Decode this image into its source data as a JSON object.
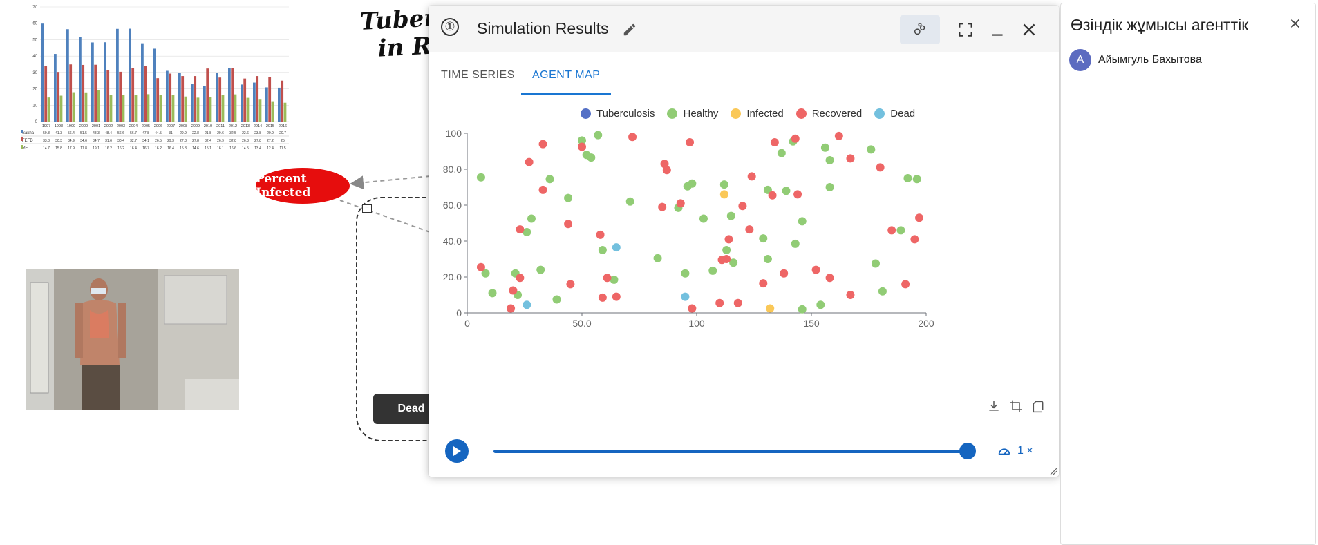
{
  "canvas": {
    "title_fragment": "Tuberc\n  in Ru",
    "percent_infected_label": "Percent Infected",
    "dead_node_label": "Dead",
    "mini_chart": {
      "years": [
        "1997",
        "1998",
        "1999",
        "2000",
        "2001",
        "2002",
        "2003",
        "2004",
        "2005",
        "2006",
        "2007",
        "2008",
        "2009",
        "2010",
        "2011",
        "2012",
        "2013",
        "2014",
        "2015",
        "2016"
      ],
      "y_ticks": [
        "70",
        "60",
        "50",
        "40",
        "30",
        "20",
        "10",
        "0"
      ],
      "rows": [
        {
          "label": "Sakha",
          "color": "#4f81bd",
          "values": [
            "59.8",
            "41.3",
            "56.4",
            "51.5",
            "48.3",
            "48.4",
            "56.6",
            "56.7",
            "47.8",
            "44.5",
            "31",
            "29.9",
            "22.8",
            "21.8",
            "29.6",
            "32.5",
            "22.6",
            "23.8",
            "20.9",
            "20.7"
          ]
        },
        {
          "label": "FEFD",
          "color": "#c0504d",
          "values": [
            "33.8",
            "30.3",
            "34.9",
            "34.6",
            "34.7",
            "31.6",
            "30.4",
            "32.7",
            "34.1",
            "26.5",
            "29.3",
            "27.8",
            "27.8",
            "32.4",
            "26.9",
            "32.8",
            "26.3",
            "27.8",
            "27.2",
            "25"
          ]
        },
        {
          "label": "RF",
          "color": "#9bbb59",
          "values": [
            "14.7",
            "15.8",
            "17.9",
            "17.8",
            "19.1",
            "16.2",
            "16.2",
            "16.4",
            "16.7",
            "16.2",
            "16.4",
            "15.3",
            "14.6",
            "15.1",
            "16.1",
            "16.6",
            "14.5",
            "13.4",
            "12.4",
            "11.5"
          ]
        }
      ]
    }
  },
  "modal": {
    "number": "①",
    "title": "Simulation Results",
    "tabs": [
      {
        "label": "TIME SERIES",
        "active": false
      },
      {
        "label": "AGENT MAP",
        "active": true
      }
    ],
    "speed_label": "1 ×",
    "playback_progress_percent": 100
  },
  "chart_data": {
    "type": "scatter",
    "xlim": [
      0,
      200
    ],
    "ylim": [
      0,
      100
    ],
    "x_ticks": [
      "0",
      "50.0",
      "100",
      "150",
      "200"
    ],
    "y_ticks": [
      "0",
      "20.0",
      "40.0",
      "60.0",
      "80.0",
      "100"
    ],
    "legend_position": "top",
    "series": [
      {
        "name": "Tuberculosis",
        "color": "#5470c6",
        "points": []
      },
      {
        "name": "Healthy",
        "color": "#91cc75",
        "points": [
          [
            6,
            75.5
          ],
          [
            8,
            22
          ],
          [
            11,
            11
          ],
          [
            21,
            22
          ],
          [
            22,
            10
          ],
          [
            26,
            45
          ],
          [
            28,
            52.5
          ],
          [
            32,
            24
          ],
          [
            36,
            74.5
          ],
          [
            39,
            7.5
          ],
          [
            44,
            64
          ],
          [
            50,
            96
          ],
          [
            52,
            88
          ],
          [
            54,
            86.5
          ],
          [
            57,
            99
          ],
          [
            59,
            35
          ],
          [
            64,
            18.5
          ],
          [
            71,
            62
          ],
          [
            83,
            30.5
          ],
          [
            92,
            58.5
          ],
          [
            95,
            22
          ],
          [
            96,
            70.5
          ],
          [
            98,
            72
          ],
          [
            103,
            52.5
          ],
          [
            107,
            23.5
          ],
          [
            112,
            71.5
          ],
          [
            113,
            35
          ],
          [
            115,
            54
          ],
          [
            116,
            28
          ],
          [
            129,
            41.5
          ],
          [
            131,
            68.5
          ],
          [
            131,
            30
          ],
          [
            137,
            89
          ],
          [
            139,
            68
          ],
          [
            142,
            95.5
          ],
          [
            143,
            38.5
          ],
          [
            146,
            51
          ],
          [
            146,
            2
          ],
          [
            156,
            92
          ],
          [
            158,
            85
          ],
          [
            158,
            70
          ],
          [
            176,
            91
          ],
          [
            178,
            27.5
          ],
          [
            181,
            12
          ],
          [
            189,
            46
          ],
          [
            192,
            75
          ],
          [
            196,
            74.5
          ],
          [
            154,
            4.5
          ]
        ]
      },
      {
        "name": "Infected",
        "color": "#fac858",
        "points": [
          [
            112,
            66
          ],
          [
            132,
            2.5
          ]
        ]
      },
      {
        "name": "Recovered",
        "color": "#ee6666",
        "points": [
          [
            6,
            25.5
          ],
          [
            19,
            2.5
          ],
          [
            20,
            12.5
          ],
          [
            23,
            19.5
          ],
          [
            23,
            46.5
          ],
          [
            27,
            84
          ],
          [
            33,
            94
          ],
          [
            33,
            68.5
          ],
          [
            44,
            49.5
          ],
          [
            45,
            16
          ],
          [
            50,
            92.5
          ],
          [
            58,
            43.5
          ],
          [
            59,
            8.5
          ],
          [
            61,
            19.5
          ],
          [
            65,
            9
          ],
          [
            72,
            98
          ],
          [
            85,
            59
          ],
          [
            86,
            83
          ],
          [
            87,
            79.5
          ],
          [
            93,
            61
          ],
          [
            97,
            95
          ],
          [
            98,
            2.5
          ],
          [
            110,
            5.5
          ],
          [
            111,
            29.5
          ],
          [
            113,
            30
          ],
          [
            114,
            41
          ],
          [
            118,
            5.5
          ],
          [
            120,
            59.5
          ],
          [
            123,
            46.5
          ],
          [
            124,
            76
          ],
          [
            129,
            16.5
          ],
          [
            133,
            65.5
          ],
          [
            134,
            95
          ],
          [
            138,
            22
          ],
          [
            143,
            97
          ],
          [
            144,
            66
          ],
          [
            152,
            24
          ],
          [
            158,
            19.5
          ],
          [
            162,
            98.5
          ],
          [
            167,
            86
          ],
          [
            167,
            10
          ],
          [
            180,
            81
          ],
          [
            185,
            46
          ],
          [
            191,
            16
          ],
          [
            195,
            41
          ],
          [
            197,
            53
          ]
        ]
      },
      {
        "name": "Dead",
        "color": "#73c0de",
        "points": [
          [
            65,
            36.5
          ],
          [
            26,
            4.5
          ],
          [
            95,
            9
          ]
        ]
      }
    ]
  },
  "right_panel": {
    "title": "Өзіндік жұмысы агенттік",
    "user_initial": "А",
    "user_name": "Айымгуль Бахытова"
  }
}
